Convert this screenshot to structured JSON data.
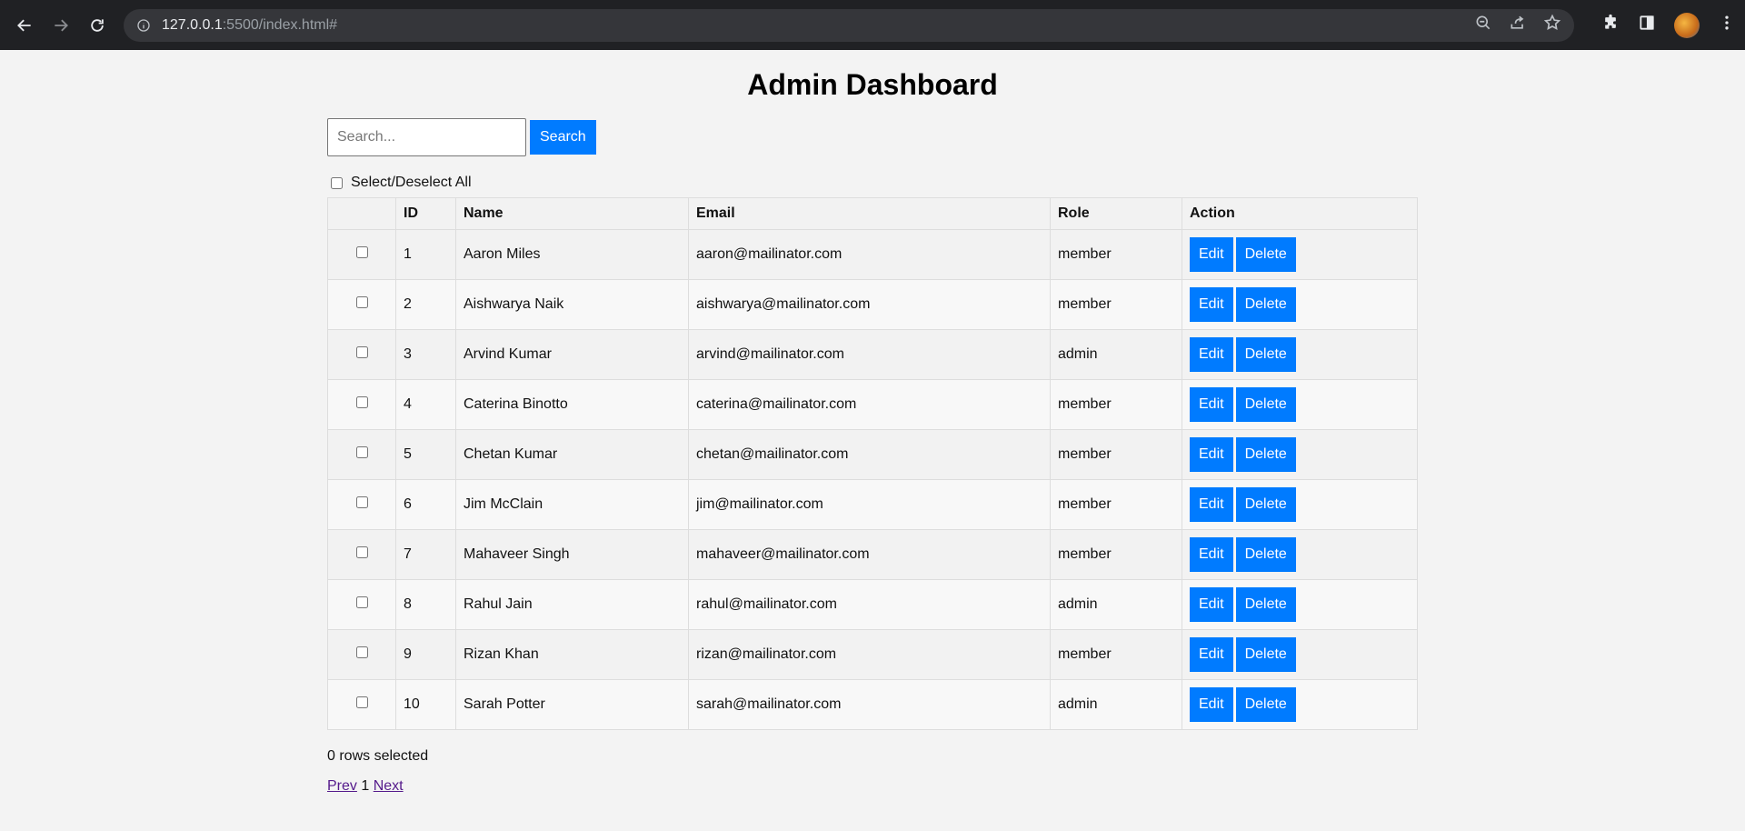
{
  "browser": {
    "url_host": "127.0.0.1",
    "url_rest": ":5500/index.html#"
  },
  "page": {
    "title": "Admin Dashboard",
    "search": {
      "placeholder": "Search...",
      "button_label": "Search"
    },
    "select_all_label": "Select/Deselect All",
    "table": {
      "headers": [
        "",
        "ID",
        "Name",
        "Email",
        "Role",
        "Action"
      ],
      "rows": [
        {
          "id": "1",
          "name": "Aaron Miles",
          "email": "aaron@mailinator.com",
          "role": "member"
        },
        {
          "id": "2",
          "name": "Aishwarya Naik",
          "email": "aishwarya@mailinator.com",
          "role": "member"
        },
        {
          "id": "3",
          "name": "Arvind Kumar",
          "email": "arvind@mailinator.com",
          "role": "admin"
        },
        {
          "id": "4",
          "name": "Caterina Binotto",
          "email": "caterina@mailinator.com",
          "role": "member"
        },
        {
          "id": "5",
          "name": "Chetan Kumar",
          "email": "chetan@mailinator.com",
          "role": "member"
        },
        {
          "id": "6",
          "name": "Jim McClain",
          "email": "jim@mailinator.com",
          "role": "member"
        },
        {
          "id": "7",
          "name": "Mahaveer Singh",
          "email": "mahaveer@mailinator.com",
          "role": "member"
        },
        {
          "id": "8",
          "name": "Rahul Jain",
          "email": "rahul@mailinator.com",
          "role": "admin"
        },
        {
          "id": "9",
          "name": "Rizan Khan",
          "email": "rizan@mailinator.com",
          "role": "member"
        },
        {
          "id": "10",
          "name": "Sarah Potter",
          "email": "sarah@mailinator.com",
          "role": "admin"
        }
      ],
      "edit_label": "Edit",
      "delete_label": "Delete"
    },
    "rows_selected_text": "0 rows selected",
    "pagination": {
      "prev": "Prev",
      "current": "1",
      "next": "Next"
    }
  },
  "colors": {
    "accent": "#007bff",
    "chrome_bg": "#202124",
    "page_bg": "#f3f3f3"
  }
}
